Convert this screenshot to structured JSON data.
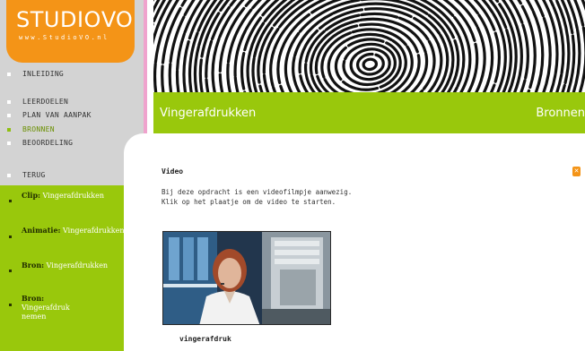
{
  "logo": {
    "title_main": "STUDIO",
    "title_vo": "VO",
    "url": "www.StudioVO.nl"
  },
  "nav": {
    "items": [
      {
        "label": "INLEIDING",
        "active": false
      },
      {
        "label": "LEERDOELEN",
        "active": false
      },
      {
        "label": "PLAN VAN AANPAK",
        "active": false
      },
      {
        "label": "BRONNEN",
        "active": true
      },
      {
        "label": "BEOORDELING",
        "active": false
      }
    ],
    "back": "TERUG"
  },
  "resources": [
    {
      "type": "Clip:",
      "name": "Vingerafdrukken"
    },
    {
      "type": "Animatie:",
      "name": "Vingerafdrukken"
    },
    {
      "type": "Bron:",
      "name": "Vingerafdrukken"
    },
    {
      "type": "Bron:",
      "name": "Vingerafdruk nemen"
    }
  ],
  "header": {
    "page_title": "Vingerafdrukken",
    "section_title": "Bronnen"
  },
  "main": {
    "heading": "Video",
    "close_icon": "x-icon",
    "description_line1": "Bij deze opdracht is een videofilmpje aanwezig.",
    "description_line2": "Klik op het plaatje om de video te starten.",
    "video_caption": "vingerafdruk"
  },
  "colors": {
    "accent_orange": "#f49417",
    "accent_green": "#99c80c",
    "sidebar_pink": "#efa3cd",
    "sidebar_grey": "#d3d3d3"
  }
}
